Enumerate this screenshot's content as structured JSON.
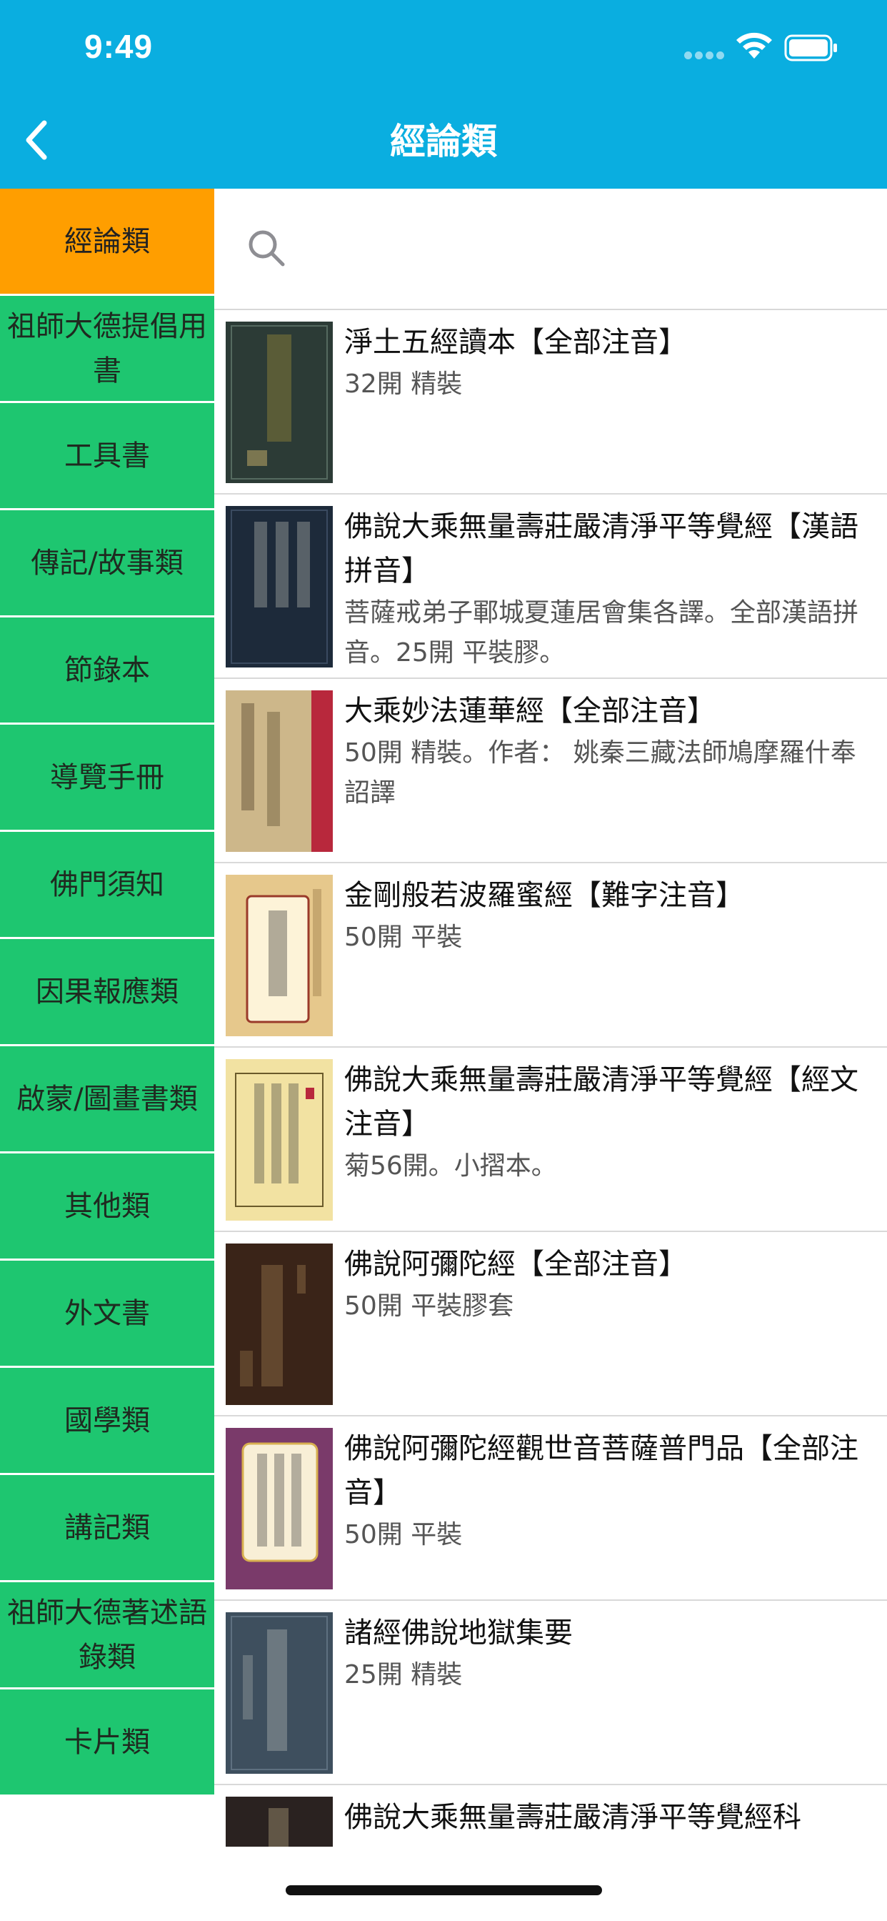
{
  "status_bar": {
    "time": "9:49"
  },
  "nav": {
    "title": "經論類",
    "back_icon": "chevron-left-icon"
  },
  "colors": {
    "header": "#0aaee0",
    "sidebar": "#1ec670",
    "sidebar_active": "#ff9e00"
  },
  "sidebar": {
    "items": [
      {
        "label": "經論類",
        "active": true
      },
      {
        "label": "祖師大德提倡用書",
        "active": false
      },
      {
        "label": "工具書",
        "active": false
      },
      {
        "label": "傳記/故事類",
        "active": false
      },
      {
        "label": "節錄本",
        "active": false
      },
      {
        "label": "導覽手冊",
        "active": false
      },
      {
        "label": "佛門須知",
        "active": false
      },
      {
        "label": "因果報應類",
        "active": false
      },
      {
        "label": "啟蒙/圖畫書類",
        "active": false
      },
      {
        "label": "其他類",
        "active": false
      },
      {
        "label": "外文書",
        "active": false
      },
      {
        "label": "國學類",
        "active": false
      },
      {
        "label": "講記類",
        "active": false
      },
      {
        "label": "祖師大德著述語錄類",
        "active": false
      },
      {
        "label": "卡片類",
        "active": false
      }
    ]
  },
  "search": {
    "placeholder": "",
    "value": ""
  },
  "books": [
    {
      "title": "淨土五經讀本【全部注音】",
      "desc": "32開 精裝"
    },
    {
      "title": "佛說大乘無量壽莊嚴清淨平等覺經【漢語拼音】",
      "desc": "菩薩戒弟子鄆城夏蓮居會集各譯。全部漢語拼音。25開 平裝膠。"
    },
    {
      "title": "大乘妙法蓮華經【全部注音】",
      "desc": "50開 精裝。作者： 姚秦三藏法師鳩摩羅什奉詔譯"
    },
    {
      "title": "金剛般若波羅蜜經【難字注音】",
      "desc": "50開 平裝"
    },
    {
      "title": "佛說大乘無量壽莊嚴清淨平等覺經【經文注音】",
      "desc": "菊56開。小摺本。"
    },
    {
      "title": "佛說阿彌陀經【全部注音】",
      "desc": "50開 平裝膠套"
    },
    {
      "title": "佛說阿彌陀經觀世音菩薩普門品【全部注音】",
      "desc": "50開 平裝"
    },
    {
      "title": "諸經佛說地獄集要",
      "desc": "25開 精裝"
    },
    {
      "title": "佛說大乘無量壽莊嚴清淨平等覺經科",
      "desc": ""
    }
  ]
}
